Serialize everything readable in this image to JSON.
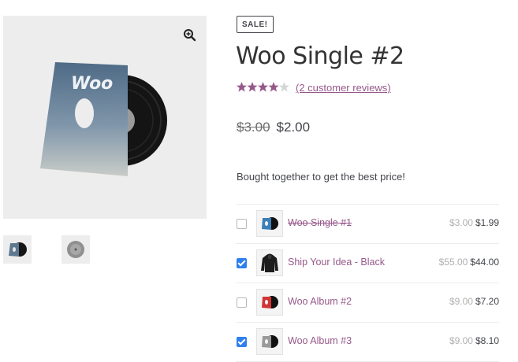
{
  "product": {
    "badge": "SALE!",
    "title": "Woo Single #2",
    "rating_value": 4.5,
    "rating_max": 5,
    "reviews_link": "(2 customer reviews)",
    "price_old": "$3.00",
    "price_new": "$2.00",
    "cover_text": "Woo"
  },
  "bundle": {
    "intro": "Bought together to get the best price!",
    "items": [
      {
        "name": "Woo Single #1",
        "price_old": "$3.00",
        "price_new": "$1.99",
        "checked": false,
        "strikethrough": true,
        "thumb_icon": "vinyl-blue-icon"
      },
      {
        "name": "Ship Your Idea - Black",
        "price_old": "$55.00",
        "price_new": "$44.00",
        "checked": true,
        "strikethrough": false,
        "thumb_icon": "hoodie-icon"
      },
      {
        "name": "Woo Album #2",
        "price_old": "$9.00",
        "price_new": "$7.20",
        "checked": false,
        "strikethrough": false,
        "thumb_icon": "vinyl-red-icon"
      },
      {
        "name": "Woo Album #3",
        "price_old": "$9.00",
        "price_new": "$8.10",
        "checked": true,
        "strikethrough": false,
        "thumb_icon": "vinyl-grey-icon"
      }
    ]
  },
  "colors": {
    "accent": "#96588a",
    "star": "#96588a",
    "checkbox": "#2f80ed",
    "text": "#43454b"
  },
  "icons": {
    "zoom": "magnifier-zoom-icon"
  }
}
